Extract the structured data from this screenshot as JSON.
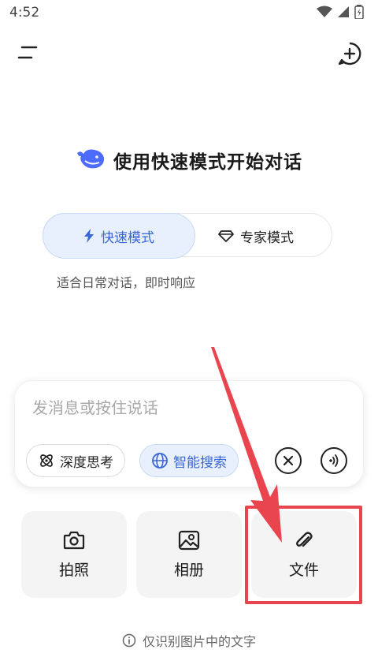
{
  "status_bar": {
    "time": "4:52"
  },
  "header": {
    "menu_icon": "menu-icon",
    "new_chat_icon": "new-chat-icon"
  },
  "welcome": {
    "title": "使用快速模式开始对话",
    "logo": "whale-logo"
  },
  "mode_switch": {
    "fast_label": "快速模式",
    "expert_label": "专家模式",
    "description": "适合日常对话，即时响应",
    "accent": "#3a66d6"
  },
  "input": {
    "placeholder": "发消息或按住说话",
    "deep_think_label": "深度思考",
    "smart_search_label": "智能搜索"
  },
  "attachments": {
    "photo_label": "拍照",
    "album_label": "相册",
    "file_label": "文件"
  },
  "footer": {
    "note": "仅识别图片中的文字"
  },
  "annotation": {
    "color": "#e8454f"
  }
}
